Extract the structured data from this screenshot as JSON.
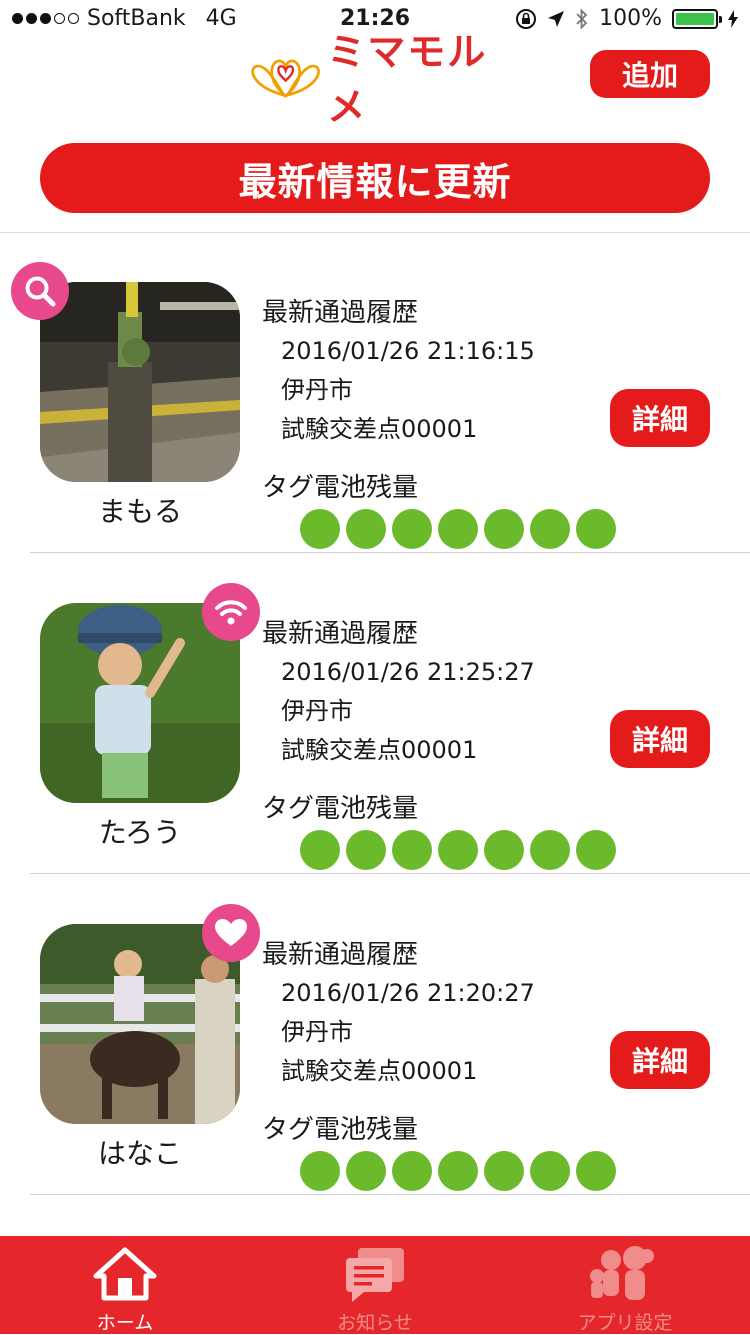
{
  "status_bar": {
    "carrier": "SoftBank",
    "network": "4G",
    "time": "21:26",
    "battery_percent": "100%",
    "signal_bars": [
      true,
      true,
      true,
      false,
      false
    ],
    "battery_level": 1.0
  },
  "header": {
    "app_name": "ミマモルメ",
    "add_button": "追加",
    "brand_color": "#e51b1b"
  },
  "refresh_button": "最新情報に更新",
  "children": [
    {
      "name": "まもる",
      "badge_icon": "search-icon",
      "history_label": "最新通過履歴",
      "datetime": "2016/01/26 21:16:15",
      "city": "伊丹市",
      "intersection": "試験交差点00001",
      "detail_button": "詳細",
      "battery_label": "タグ電池残量",
      "battery_dots": 7
    },
    {
      "name": "たろう",
      "badge_icon": "wifi-icon",
      "history_label": "最新通過履歴",
      "datetime": "2016/01/26 21:25:27",
      "city": "伊丹市",
      "intersection": "試験交差点00001",
      "detail_button": "詳細",
      "battery_label": "タグ電池残量",
      "battery_dots": 7
    },
    {
      "name": "はなこ",
      "badge_icon": "heart-icon",
      "history_label": "最新通過履歴",
      "datetime": "2016/01/26 21:20:27",
      "city": "伊丹市",
      "intersection": "試験交差点00001",
      "detail_button": "詳細",
      "battery_label": "タグ電池残量",
      "battery_dots": 7
    }
  ],
  "tabs": [
    {
      "label": "ホーム",
      "icon": "home-icon",
      "active": true
    },
    {
      "label": "お知らせ",
      "icon": "chat-icon",
      "active": false
    },
    {
      "label": "アプリ設定",
      "icon": "family-icon",
      "active": false
    }
  ]
}
